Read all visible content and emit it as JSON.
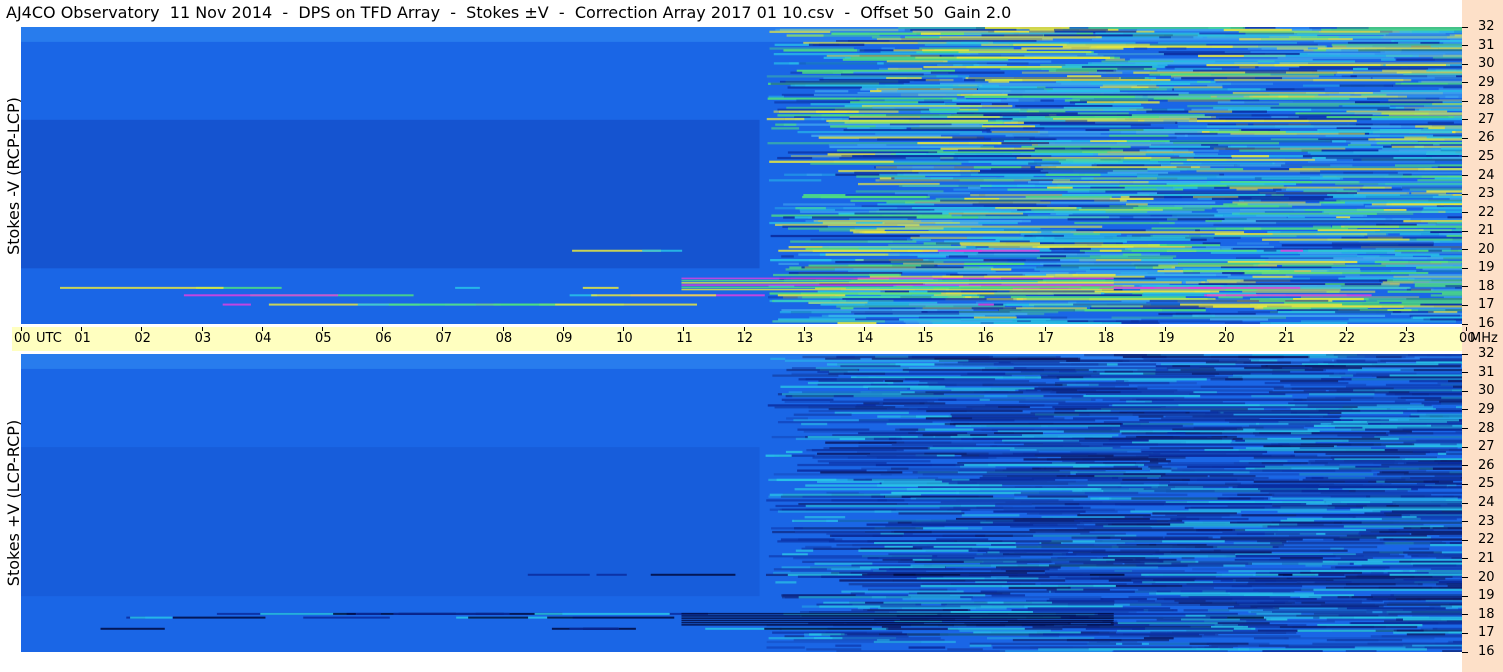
{
  "title": "AJ4CO Observatory  11 Nov 2014  -  DPS on TFD Array  -  Stokes ±V  -  Correction Array 2017 01 10.csv  -  Offset 50  Gain 2.0",
  "colors": {
    "background_blue": "#1a66e6",
    "dark_blue": "#0a2c9e",
    "cyan": "#29c4e8",
    "green": "#4fe080",
    "yellow": "#e8e840",
    "magenta": "#e040e0",
    "time_axis_bg": "#ffffc0",
    "freq_axis_bg": "#fde0c8"
  },
  "chart_data": [
    {
      "type": "heatmap",
      "panel": "top",
      "ylabel": "Stokes -V (RCP-LCP)",
      "y_unit": "MHz",
      "ylim": [
        16,
        32
      ],
      "y_ticks": [
        "32",
        "31",
        "30",
        "29",
        "28",
        "27",
        "26",
        "25",
        "24",
        "23",
        "22",
        "21",
        "20",
        "19",
        "18",
        "17",
        "16"
      ],
      "x_ticks": [
        "00",
        "01",
        "02",
        "03",
        "04",
        "05",
        "06",
        "07",
        "08",
        "09",
        "10",
        "11",
        "12",
        "13",
        "14",
        "15",
        "16",
        "17",
        "18",
        "19",
        "20",
        "21",
        "22",
        "23",
        "00"
      ],
      "x_unit": "UTC",
      "xlim": [
        0,
        24
      ],
      "colormap": "blue-cyan-green-yellow-magenta"
    },
    {
      "type": "heatmap",
      "panel": "bottom",
      "ylabel": "Stokes +V (LCP-RCP)",
      "y_unit": "MHz",
      "ylim": [
        16,
        32
      ],
      "y_ticks": [
        "32",
        "31",
        "30",
        "29",
        "28",
        "27",
        "26",
        "25",
        "24",
        "23",
        "22",
        "21",
        "20",
        "19",
        "18",
        "17",
        "16"
      ],
      "x_ticks": [
        "00",
        "01",
        "02",
        "03",
        "04",
        "05",
        "06",
        "07",
        "08",
        "09",
        "10",
        "11",
        "12",
        "13",
        "14",
        "15",
        "16",
        "17",
        "18",
        "19",
        "20",
        "21",
        "22",
        "23",
        "00"
      ],
      "x_unit": "UTC",
      "xlim": [
        0,
        24
      ],
      "colormap": "blue-cyan-green-yellow-magenta"
    }
  ],
  "time_axis": {
    "hours": [
      "00",
      "01",
      "02",
      "03",
      "04",
      "05",
      "06",
      "07",
      "08",
      "09",
      "10",
      "11",
      "12",
      "13",
      "14",
      "15",
      "16",
      "17",
      "18",
      "19",
      "20",
      "21",
      "22",
      "23",
      "00"
    ],
    "utc_label": "UTC",
    "mhz_label": "MHz"
  }
}
